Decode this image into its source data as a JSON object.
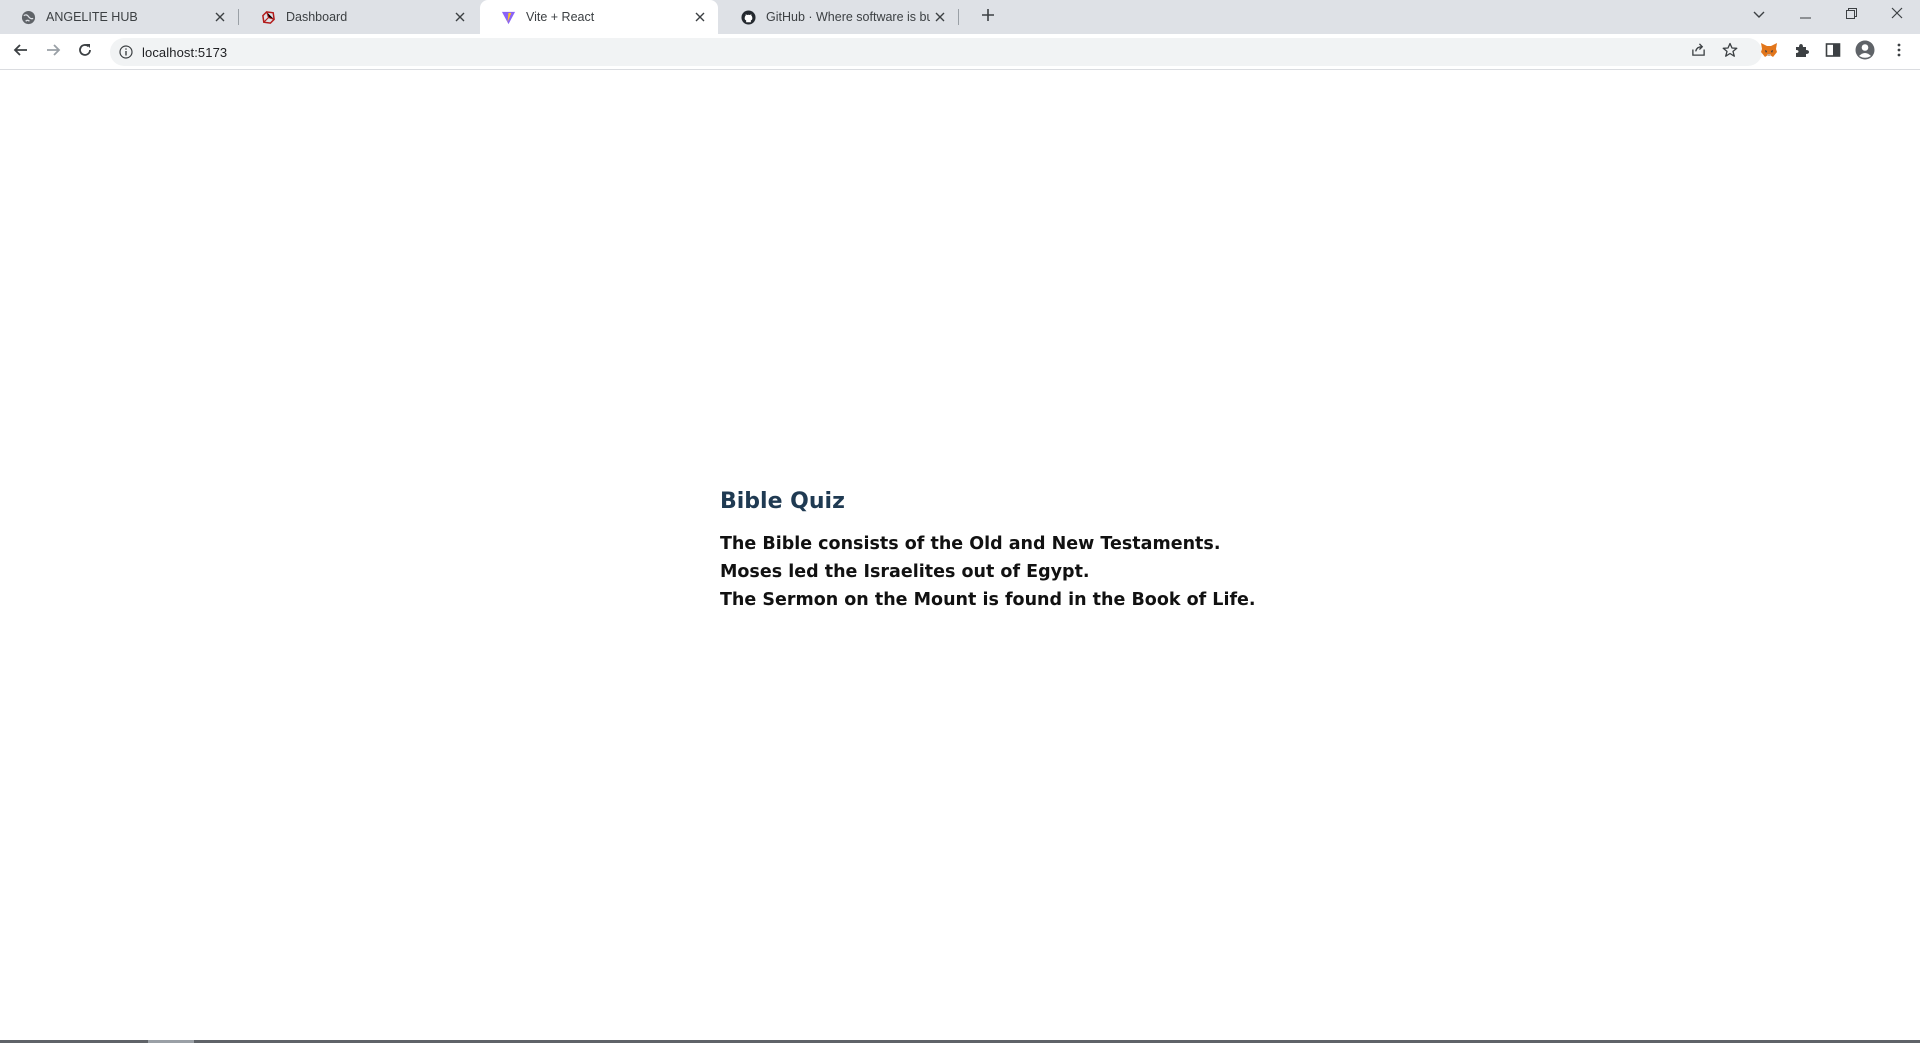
{
  "browser": {
    "tabs": [
      {
        "title": "ANGELITE HUB",
        "icon": "globe-icon",
        "active": false
      },
      {
        "title": "Dashboard",
        "icon": "ruby-icon",
        "active": false
      },
      {
        "title": "Vite + React",
        "icon": "vite-icon",
        "active": true
      },
      {
        "title": "GitHub · Where software is built",
        "icon": "github-icon",
        "active": false
      }
    ],
    "url": "localhost:5173"
  },
  "page": {
    "title": "Bible Quiz",
    "lines": [
      "The Bible consists of the Old and New Testaments.",
      "Moses led the Israelites out of Egypt.",
      "The Sermon on the Mount is found in the Book of Life."
    ]
  },
  "colors": {
    "tabstrip": "#dee1e6",
    "heading": "#1f3a52",
    "text": "#111111"
  }
}
